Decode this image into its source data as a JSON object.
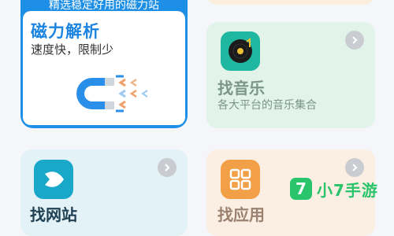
{
  "magnet_card": {
    "banner": "精选稳定好用的磁力站",
    "title": "磁力解析",
    "subtitle": "速度快，限制少"
  },
  "music_card": {
    "title": "找音乐",
    "subtitle": "各大平台的音乐集合",
    "icon": "vinyl-music-icon"
  },
  "web_card": {
    "title": "找网站",
    "icon": "fish-icon"
  },
  "app_card": {
    "title": "找应用",
    "icon": "app-grid-icon"
  },
  "watermark": {
    "badge": "7",
    "text": "小7手游"
  },
  "colors": {
    "magnet_blue": "#1e8fe6",
    "music_bg": "#e2f4ea",
    "web_bg": "#e3f2f6",
    "app_bg": "#fbeee2",
    "watermark_green": "#29c46b"
  }
}
